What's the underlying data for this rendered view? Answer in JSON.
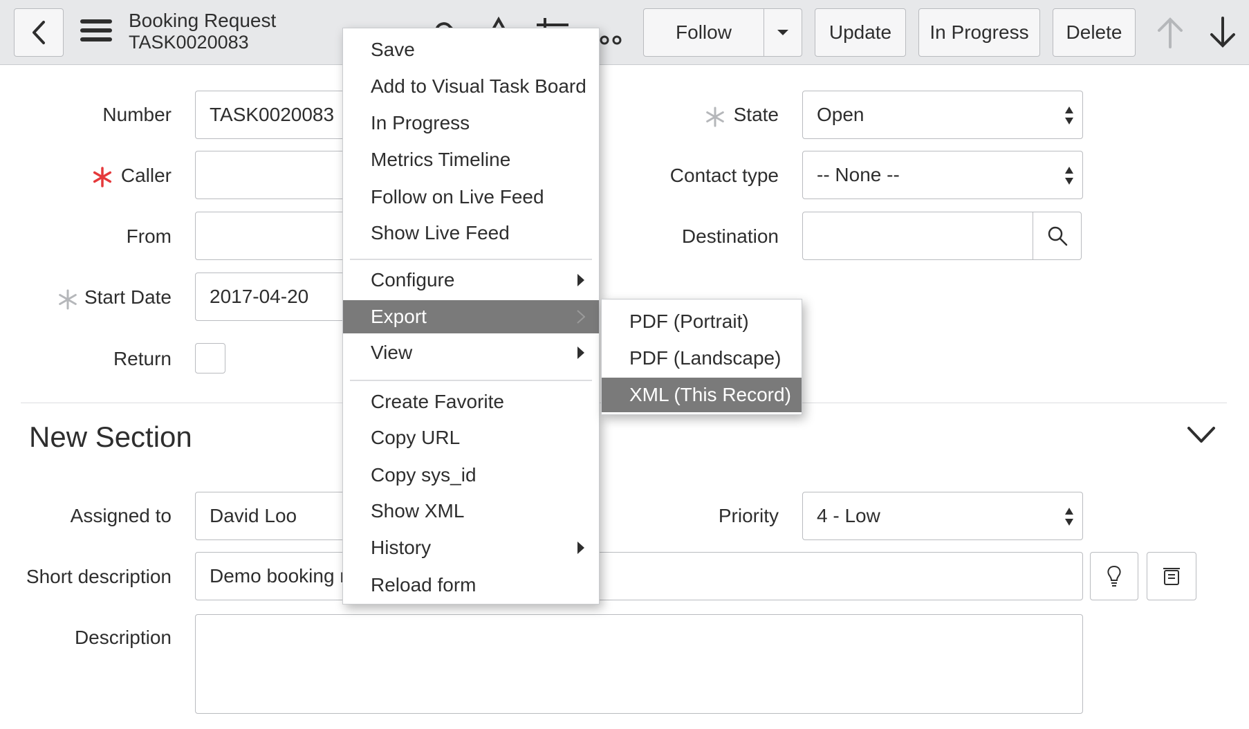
{
  "header": {
    "title": "Booking Request",
    "number": "TASK0020083",
    "follow_label": "Follow",
    "update_label": "Update",
    "in_progress_label": "In Progress",
    "delete_label": "Delete"
  },
  "form": {
    "number_label": "Number",
    "number_value": "TASK0020083",
    "caller_label": "Caller",
    "from_label": "From",
    "start_date_label": "Start Date",
    "start_date_value": "2017-04-20",
    "return_label": "Return",
    "state_label": "State",
    "state_value": "Open",
    "contact_type_label": "Contact type",
    "contact_type_value": "-- None --",
    "destination_label": "Destination"
  },
  "section": {
    "title": "New Section",
    "assigned_to_label": "Assigned to",
    "assigned_to_value": "David Loo",
    "priority_label": "Priority",
    "priority_value": "4 - Low",
    "short_description_label": "Short description",
    "short_description_value": "Demo booking r",
    "description_label": "Description"
  },
  "context_menu": {
    "items": [
      {
        "label": "Save"
      },
      {
        "label": "Add to Visual Task Board"
      },
      {
        "label": "In Progress"
      },
      {
        "label": "Metrics Timeline"
      },
      {
        "label": "Follow on Live Feed"
      },
      {
        "label": "Show Live Feed"
      },
      {
        "label": "Configure"
      },
      {
        "label": "Export"
      },
      {
        "label": "View"
      },
      {
        "label": "Create Favorite"
      },
      {
        "label": "Copy URL"
      },
      {
        "label": "Copy sys_id"
      },
      {
        "label": "Show XML"
      },
      {
        "label": "History"
      },
      {
        "label": "Reload form"
      }
    ],
    "active_item": "Export"
  },
  "export_submenu": {
    "items": [
      {
        "label": "PDF (Portrait)"
      },
      {
        "label": "PDF (Landscape)"
      },
      {
        "label": "XML (This Record)"
      }
    ],
    "active_item": "XML (This Record)"
  },
  "colors": {
    "header_bg": "#e7e8ea",
    "required_red": "#e5393b",
    "menu_active_bg": "#7a7a7a"
  }
}
